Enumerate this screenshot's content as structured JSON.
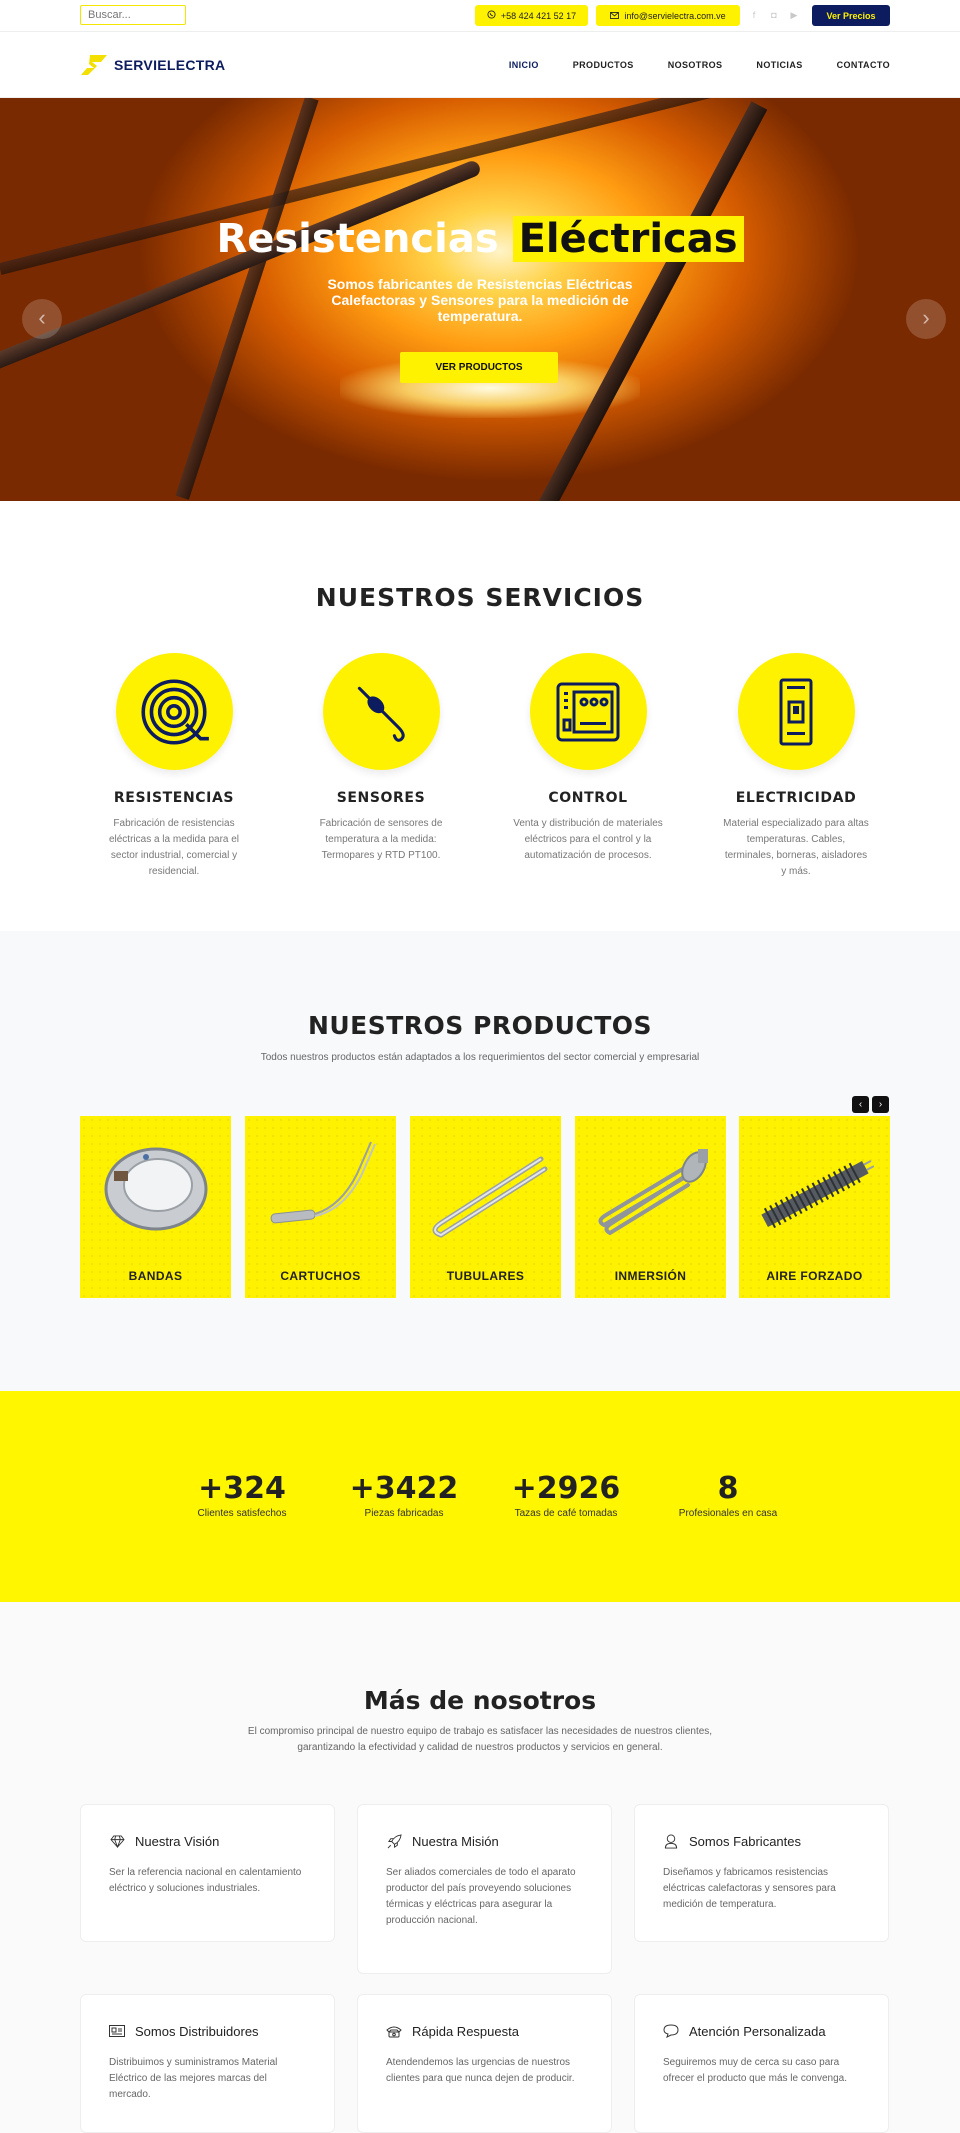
{
  "topbar": {
    "search_placeholder": "Buscar...",
    "phone": "+58 424 421 52 17",
    "email": "info@servielectra.com.ve",
    "social_icons": [
      "facebook-icon",
      "instagram-icon",
      "youtube-icon"
    ],
    "precios_label": "Ver Precios"
  },
  "header": {
    "logo_text": "SERVIELECTRA",
    "nav": [
      "INICIO",
      "PRODUCTOS",
      "NOSOTROS",
      "NOTICIAS",
      "CONTACTO"
    ]
  },
  "hero": {
    "title_plain": "Resistencias",
    "title_highlight": "Eléctricas",
    "subtitle": "Somos fabricantes de Resistencias Eléctricas Calefactoras y Sensores para la medición de temperatura.",
    "button": "VER PRODUCTOS"
  },
  "services": {
    "title": "NUESTROS SERVICIOS",
    "items": [
      {
        "title": "RESISTENCIAS",
        "text": "Fabricación de resistencias eléctricas a la medida para el sector industrial, comercial y residencial."
      },
      {
        "title": "SENSORES",
        "text": "Fabricación de sensores de temperatura a la medida: Termopares y RTD PT100."
      },
      {
        "title": "CONTROL",
        "text": "Venta y distribución de materiales eléctricos para el control y la automatización de procesos."
      },
      {
        "title": "ELECTRICIDAD",
        "text": "Material especializado para altas temperaturas. Cables, terminales, borneras, aisladores y más."
      }
    ]
  },
  "products": {
    "title": "NUESTROS PRODUCTOS",
    "lead": "Todos nuestros productos están adaptados a los requerimientos del sector comercial y empresarial",
    "items": [
      "BANDAS",
      "CARTUCHOS",
      "TUBULARES",
      "INMERSIÓN",
      "AIRE FORZADO"
    ]
  },
  "counters": [
    {
      "num": "+324",
      "label": "Clientes satisfechos"
    },
    {
      "num": "+3422",
      "label": "Piezas fabricadas"
    },
    {
      "num": "+2926",
      "label": "Tazas de café tomadas"
    },
    {
      "num": "8",
      "label": "Profesionales en casa"
    }
  ],
  "about": {
    "title": "Más de nosotros",
    "lead": "El compromiso principal de nuestro equipo de trabajo es satisfacer las necesidades de nuestros clientes, garantizando la efectividad y calidad de nuestros productos y servicios en general.",
    "boxes": [
      {
        "icon": "diamond-icon",
        "title": "Nuestra Visión",
        "text": "Ser la referencia nacional en calentamiento eléctrico y soluciones industriales."
      },
      {
        "icon": "rocket-icon",
        "title": "Nuestra Misión",
        "text": "Ser aliados comerciales de todo el aparato productor del país proveyendo soluciones térmicas y eléctricas para asegurar la producción nacional."
      },
      {
        "icon": "user-icon",
        "title": "Somos Fabricantes",
        "text": "Diseñamos y fabricamos resistencias eléctricas calefactoras y sensores para medición de temperatura."
      },
      {
        "icon": "id-card-icon",
        "title": "Somos Distribuidores",
        "text": "Distribuimos y suministramos Material Eléctrico de las mejores marcas del mercado."
      },
      {
        "icon": "telephone-icon",
        "title": "Rápida Respuesta",
        "text": "Atendendemos las urgencias de nuestros clientes para que nunca dejen de producir."
      },
      {
        "icon": "chat-bubble-icon",
        "title": "Atención Personalizada",
        "text": "Seguiremos muy de cerca su caso para ofrecer el producto que más le convenga."
      }
    ]
  },
  "colors": {
    "brand_yellow": "#fff200",
    "brand_navy": "#0c1c5e"
  }
}
